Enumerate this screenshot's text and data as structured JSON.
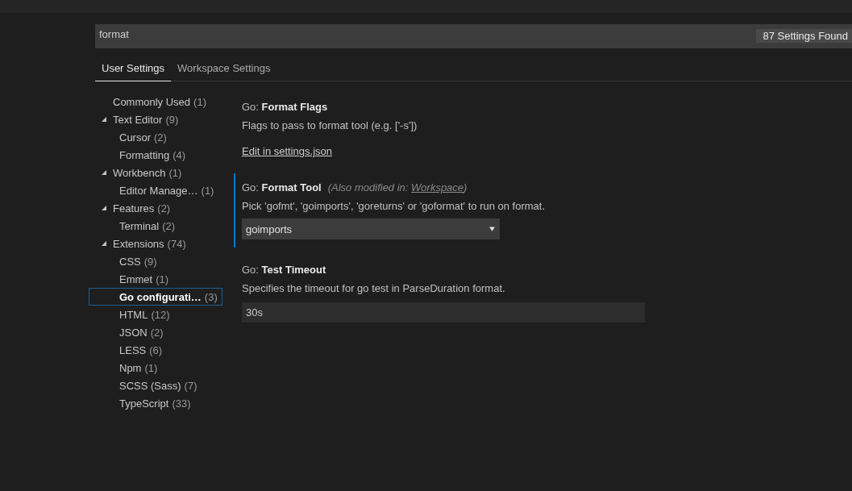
{
  "search": {
    "value": "format",
    "result_count": "87 Settings Found"
  },
  "tabs": [
    {
      "label": "User Settings",
      "selected": true
    },
    {
      "label": "Workspace Settings",
      "selected": false
    }
  ],
  "tree": [
    {
      "label": "Commonly Used",
      "count": "(1)",
      "selected": false
    },
    {
      "label": "Text Editor",
      "count": "(9)",
      "expanded": true,
      "selected": false,
      "children": [
        {
          "label": "Cursor",
          "count": "(2)",
          "selected": false
        },
        {
          "label": "Formatting",
          "count": "(4)",
          "selected": false
        }
      ]
    },
    {
      "label": "Workbench",
      "count": "(1)",
      "expanded": true,
      "selected": false,
      "children": [
        {
          "label": "Editor Manage…",
          "count": "(1)",
          "selected": false
        }
      ]
    },
    {
      "label": "Features",
      "count": "(2)",
      "expanded": true,
      "selected": false,
      "children": [
        {
          "label": "Terminal",
          "count": "(2)",
          "selected": false
        }
      ]
    },
    {
      "label": "Extensions",
      "count": "(74)",
      "expanded": true,
      "selected": false,
      "children": [
        {
          "label": "CSS",
          "count": "(9)",
          "selected": false
        },
        {
          "label": "Emmet",
          "count": "(1)",
          "selected": false
        },
        {
          "label": "Go configurati…",
          "count": "(3)",
          "selected": true
        },
        {
          "label": "HTML",
          "count": "(12)",
          "selected": false
        },
        {
          "label": "JSON",
          "count": "(2)",
          "selected": false
        },
        {
          "label": "LESS",
          "count": "(6)",
          "selected": false
        },
        {
          "label": "Npm",
          "count": "(1)",
          "selected": false
        },
        {
          "label": "SCSS (Sass)",
          "count": "(7)",
          "selected": false
        },
        {
          "label": "TypeScript",
          "count": "(33)",
          "selected": false
        }
      ]
    }
  ],
  "settings": [
    {
      "kind": "link",
      "category": "Go:",
      "name": "Format Flags",
      "description": "Flags to pass to format tool (e.g. ['-s'])",
      "link": "Edit in settings.json",
      "modified": false
    },
    {
      "kind": "dropdown",
      "category": "Go:",
      "name": "Format Tool",
      "note_prefix": "(Also modified in: ",
      "note_link": "Workspace",
      "note_suffix": ")",
      "description": "Pick 'gofmt', 'goimports', 'goreturns' or 'goformat' to run on format.",
      "value": "goimports",
      "modified": true
    },
    {
      "kind": "input",
      "category": "Go:",
      "name": "Test Timeout",
      "description": "Specifies the timeout for go test in ParseDuration format.",
      "value": "30s",
      "modified": false
    }
  ]
}
